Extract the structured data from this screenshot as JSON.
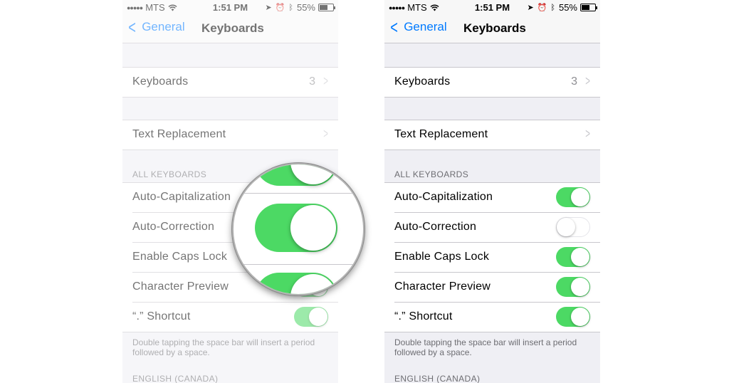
{
  "statusbar": {
    "carrier": "MTS",
    "time": "1:51 PM",
    "battery_left": "55%",
    "battery_right": "55%"
  },
  "navbar": {
    "back_label": "General",
    "title": "Keyboards"
  },
  "keyboards_cell": {
    "label": "Keyboards",
    "value": "3"
  },
  "text_replacement": {
    "label": "Text Replacement"
  },
  "all_keyboards": {
    "header": "ALL KEYBOARDS",
    "items": [
      {
        "label": "Auto-Capitalization",
        "left_on": true,
        "right_on": true
      },
      {
        "label": "Auto-Correction",
        "left_on": true,
        "right_on": false
      },
      {
        "label": "Enable Caps Lock",
        "left_on": true,
        "right_on": true
      },
      {
        "label": "Character Preview",
        "left_on": true,
        "right_on": true
      },
      {
        "label": "“.” Shortcut",
        "left_on": true,
        "right_on": true
      }
    ],
    "footer": "Double tapping the space bar will insert a period followed by a space."
  },
  "english_section": {
    "header": "ENGLISH (CANADA)"
  },
  "icons": [
    "signal-dots-icon",
    "wifi-icon",
    "location-arrow-icon",
    "alarm-icon",
    "bluetooth-icon",
    "battery-icon",
    "back-chevron-icon",
    "disclosure-chevron-icon"
  ],
  "colors": {
    "accent": "#007aff",
    "toggle_on": "#4cd964",
    "background": "#efeff4"
  }
}
